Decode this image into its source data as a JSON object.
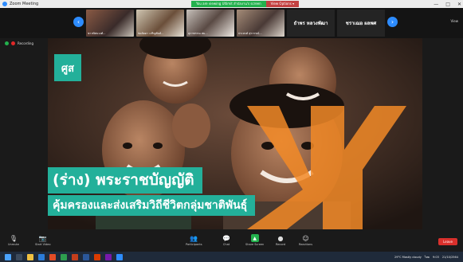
{
  "window": {
    "title": "Zoom Meeting"
  },
  "banner": {
    "message": "You are viewing Ultimit สำนักงาน's screen",
    "options": "View Options ▾"
  },
  "controls_window": [
    "—",
    "□",
    "✕"
  ],
  "strip": {
    "participants": [
      {
        "name": "ชาวทัศนวงศ์..."
      },
      {
        "name": "ช่อลัดดา เจริญพันธ์..."
      },
      {
        "name": "สุภาพรรณ สม..."
      },
      {
        "name": "ประสงค์ สุรวรรณ์..."
      }
    ],
    "named": [
      "ธำพร หลวงพัฒา",
      "ชราเฌอ ผลพศ"
    ],
    "view": "View"
  },
  "indicators": {
    "recording": "Recording"
  },
  "slide": {
    "logo": "ศูส",
    "title": "(ร่าง) พระราชบัญญัติ",
    "subtitle": "คุ้มครองและส่งเสริมวิถีชีวิตกลุ่มชาติพันธุ์"
  },
  "toolbar": {
    "unmute": "Unmute",
    "start_video": "Start Video",
    "participants": "Participants",
    "participants_count": "11",
    "chat": "Chat",
    "share_screen": "Share Screen",
    "record": "Record",
    "reactions": "Reactions",
    "leave": "Leave"
  },
  "taskbar": {
    "weather": "29°C Mostly cloudy",
    "lang": "ไทย",
    "time": "9:03",
    "date": "21/10/2564"
  },
  "colors": {
    "accent": "#23b09a",
    "orange": "#f28a27",
    "zoom_blue": "#2d8cff",
    "leave_red": "#d9302c"
  }
}
